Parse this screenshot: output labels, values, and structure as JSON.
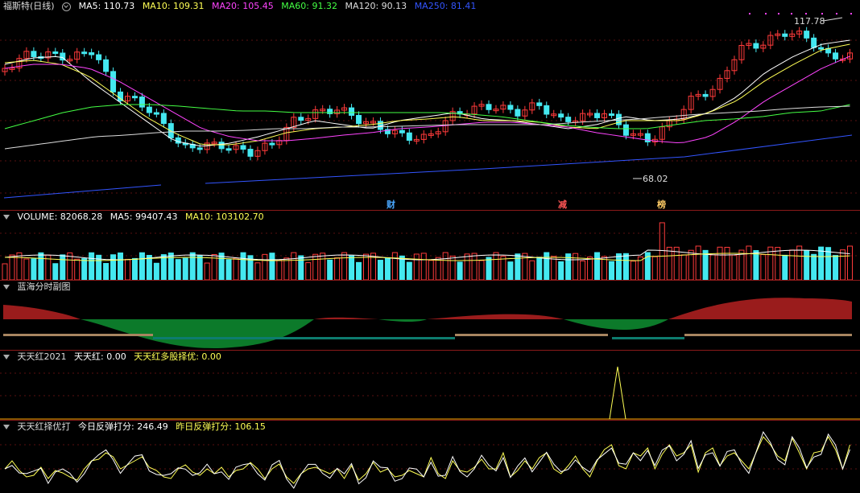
{
  "main": {
    "title": "福斯特(日线)",
    "ma": [
      {
        "label": "MA5: 110.73",
        "color": "#ffffff"
      },
      {
        "label": "MA10: 109.31",
        "color": "#ffff55"
      },
      {
        "label": "MA20: 105.45",
        "color": "#ff44ff"
      },
      {
        "label": "MA60: 91.32",
        "color": "#44ff44"
      },
      {
        "label": "MA120: 90.13",
        "color": "#dddddd"
      },
      {
        "label": "MA250: 81.41",
        "color": "#3355ff"
      }
    ],
    "high_label": "117.78",
    "low_label": "68.02",
    "badges": [
      {
        "text": "财",
        "color": "#4aa8ff"
      },
      {
        "text": "减",
        "color": "#ff5555"
      },
      {
        "text": "榜",
        "color": "#ffcc66"
      }
    ]
  },
  "volume": {
    "label": "VOLUME: 82068.28",
    "ma5": "MA5: 99407.43",
    "ma10": "MA10: 103102.70"
  },
  "lanhai": {
    "label": "蓝海分时副图"
  },
  "ttred": {
    "label": "天天红2021",
    "v1": "天天红: 0.00",
    "v2": "天天红多股择优: 0.00"
  },
  "ttscore": {
    "label": "天天红择优打",
    "v1": "今日反弹打分: 246.49",
    "v2": "昨日反弹打分: 106.15"
  },
  "colors": {
    "up": "#ff3b3b",
    "down": "#44e8f0",
    "grid": "#5a1010"
  }
}
